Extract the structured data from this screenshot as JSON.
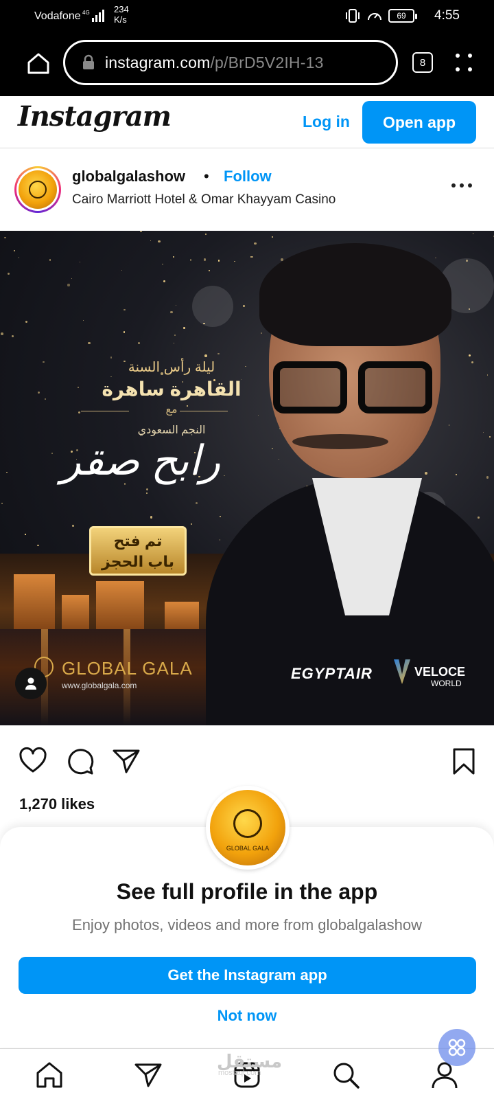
{
  "status_bar": {
    "carrier": "Vodafone",
    "network": "4G",
    "speed_value": "234",
    "speed_unit": "K/s",
    "battery": "69",
    "time": "4:55"
  },
  "browser": {
    "url_host": "instagram.com",
    "url_path": "/p/BrD5V2IH-13",
    "tab_count": "8"
  },
  "ig_header": {
    "logo": "Instagram",
    "login_label": "Log in",
    "open_app_label": "Open app"
  },
  "post": {
    "username": "globalgalashow",
    "separator": "•",
    "follow_label": "Follow",
    "location": "Cairo Marriott Hotel & Omar Khayyam Casino",
    "likes": "1,270 likes",
    "image": {
      "line1": "ليلة رأس السنة",
      "line2": "القاهرة ساهرة",
      "line3": "مع",
      "line4": "النجم السعودي",
      "star_name": "رابح صقر",
      "badge_line1": "تم فتح",
      "badge_line2": "باب الحجز",
      "brand_name": "GLOBAL GALA",
      "brand_url": "www.globalgala.com",
      "sponsor1": "EGYPTAIR",
      "sponsor2_line1": "VELOCE",
      "sponsor2_line2": "WORLD"
    }
  },
  "sheet": {
    "avatar_caption": "GLOBAL GALA",
    "title": "See full profile in the app",
    "subtitle": "Enjoy photos, videos and more from globalgalashow",
    "get_app_label": "Get the Instagram app",
    "not_now_label": "Not now"
  },
  "watermark": {
    "text": "مستقل",
    "sub": "mostaql.com"
  },
  "colors": {
    "accent": "#0095f6",
    "gold": "#d8a94a"
  }
}
